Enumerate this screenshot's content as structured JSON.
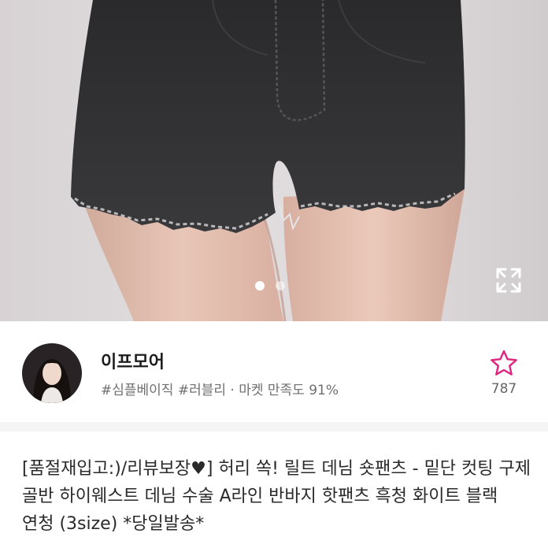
{
  "product": {
    "image_alt": "black denim shorts",
    "image_count": 2,
    "current_image": 1
  },
  "seller": {
    "name": "이프모어",
    "meta": "#심플베이직 #러블리 · 마켓 만족도 91%",
    "like_count": "787"
  },
  "listing": {
    "title": "[품절재입고:)/리뷰보장♥] 허리 쏙! 릴트 데님 숏팬츠 - 밑단 컷팅 구제 골반 하이웨스트 데님 수술 A라인 반바지 핫팬츠 흑청 화이트 블랙 연청 (3size) *당일발송*"
  },
  "colors": {
    "accent": "#e0257f",
    "text": "#2a2a2a",
    "muted": "#6f6f6f",
    "divider": "#f5f5f5"
  },
  "icons": {
    "like": "star-outline-icon",
    "expand": "expand-icon"
  }
}
